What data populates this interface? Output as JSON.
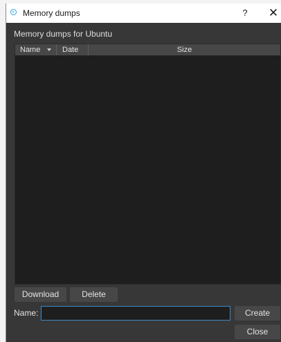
{
  "window": {
    "title": "Memory dumps",
    "help_label": "?",
    "close_label": "✕",
    "icon": "app-logo-icon"
  },
  "group": {
    "label": "Memory dumps for Ubuntu"
  },
  "table": {
    "columns": [
      {
        "label": "Name",
        "sorted": "descending"
      },
      {
        "label": "Date"
      },
      {
        "label": "Size"
      }
    ],
    "rows": []
  },
  "actions": {
    "download_label": "Download",
    "delete_label": "Delete",
    "create_label": "Create",
    "close_label": "Close"
  },
  "name_field": {
    "label": "Name:",
    "value": ""
  },
  "colors": {
    "dialog_background": "#373737",
    "table_background": "#1e1e1e",
    "button_background": "#474747",
    "input_focus_border": "#3f88c5",
    "app_icon": "#2ba6df"
  }
}
